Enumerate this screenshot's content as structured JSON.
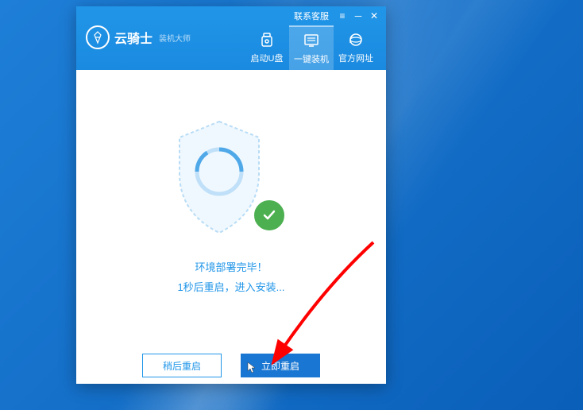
{
  "titlebar": {
    "contact_label": "联系客服"
  },
  "logo": {
    "title": "云骑士",
    "subtitle": "装机大师"
  },
  "nav": {
    "tabs": [
      {
        "label": "启动U盘"
      },
      {
        "label": "一键装机"
      },
      {
        "label": "官方网址"
      }
    ]
  },
  "status": {
    "complete": "环境部署完毕！",
    "countdown": "1秒后重启，进入安装..."
  },
  "buttons": {
    "later": "稍后重启",
    "now": "立即重启"
  },
  "colors": {
    "primary": "#1976d2",
    "accent": "#2196e8",
    "success": "#4caf50"
  }
}
